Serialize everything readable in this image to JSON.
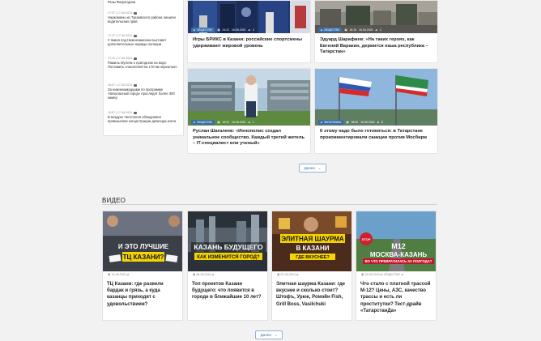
{
  "sidebar": {
    "items": [
      {
        "meta": "",
        "title": "Резы Фахретдина"
      },
      {
        "meta": "17:37 | 17-06-2024",
        "title": "Наркоманы из Тукаевского района лишили водительских прав"
      },
      {
        "meta": "17:27 | 17-06-2024",
        "title": "У якиня под Нижнекамском выставят дополнительные наряды полиции"
      },
      {
        "meta": "17:16 | 17-06-2024",
        "title": "Рамиль Мулляк о пригодном на воде: Поставить спасателей на 170 км нереально"
      },
      {
        "meta": "16:57 | 17-06-2024",
        "title": "За нижнекамадцами по программе «Безопасный город» проследят более 300 камер"
      },
      {
        "meta": "16:57 | 17-06-2024",
        "title": "В воздухе Чистополя обнаружили превышение концентрации диоксида азота"
      }
    ]
  },
  "articles": [
    {
      "category": "ОБЩЕСТВО",
      "time": "21:21",
      "date": "16-06-2024",
      "comments": "2",
      "title": "Игры БРИКС в Казани: российские спортсмены удерживают мировой уровень"
    },
    {
      "category": "ОБЩЕСТВО",
      "time": "18:16",
      "date": "16-06-2024",
      "comments": "2",
      "title": "Эдуард Шарафиев: «На таких героях, как Евгений Варакин, держится наша республика – Татарстан»"
    },
    {
      "category": "ОБЩЕСТВО",
      "time": "15:02",
      "date": "16-06-2024",
      "comments": "1",
      "title": "Руслан Шагалеев: «Иннополис создал уникальное сообщество. Каждый третий житель – IT-специалист или ученый»"
    },
    {
      "category": "ЭКОНОМИКА",
      "time": "08:00",
      "date": "16-06-2024",
      "comments": "8",
      "title": "К этому надо было готовиться: в Татарстане прокомментировали санкции против Мосбирж"
    }
  ],
  "more_label": "Далее",
  "video_section_title": "ВИДЕО",
  "videos": [
    {
      "date": "19-06-2024",
      "category": "",
      "title": "ТЦ Казани: где развели бардак и грязь, а куда казанцы приходят с удовольствием?",
      "thumb_text": [
        "И ЭТО ЛУЧШИЕ",
        "ТЦ КАЗАНИ?"
      ],
      "accent": "#f5d400"
    },
    {
      "date": "06-06-2024",
      "category": "",
      "title": "Топ проектов Казани будущего: что появится в городе в ближайшие 10 лет?",
      "thumb_text": [
        "КАЗАНЬ БУДУЩЕГО",
        "КАК ИЗМЕНИТСЯ ГОРОД?"
      ],
      "accent": "#f5d400"
    },
    {
      "date": "03-06-2024",
      "category": "",
      "title": "Элитная шаурма Казани: где вкуснее и сколько стоит? Штофъ, Урюк, Ромэйн Fish, Grill Boss, Vasilchuki",
      "thumb_text": [
        "ЭЛИТНАЯ ШАУРМА",
        "В КАЗАНИ",
        "ГДЕ ВКУСНЕЕ?"
      ],
      "accent": "#f5d400"
    },
    {
      "date": "29-05-2024",
      "category": "ОБЩЕСТВО",
      "title": "Что стало с платной трассой М-12? Цены, АЗС, качество трассы и есть ли проститутки? Тест-драйв «ТатарстанДа»",
      "thumb_text": [
        "М12",
        "МОСКВА-КАЗАНЬ",
        "ВО ЧТО ПРЕВРАТИЛАСЬ ЗА ПОЛГОДА?"
      ],
      "accent": "#c3162b"
    }
  ]
}
